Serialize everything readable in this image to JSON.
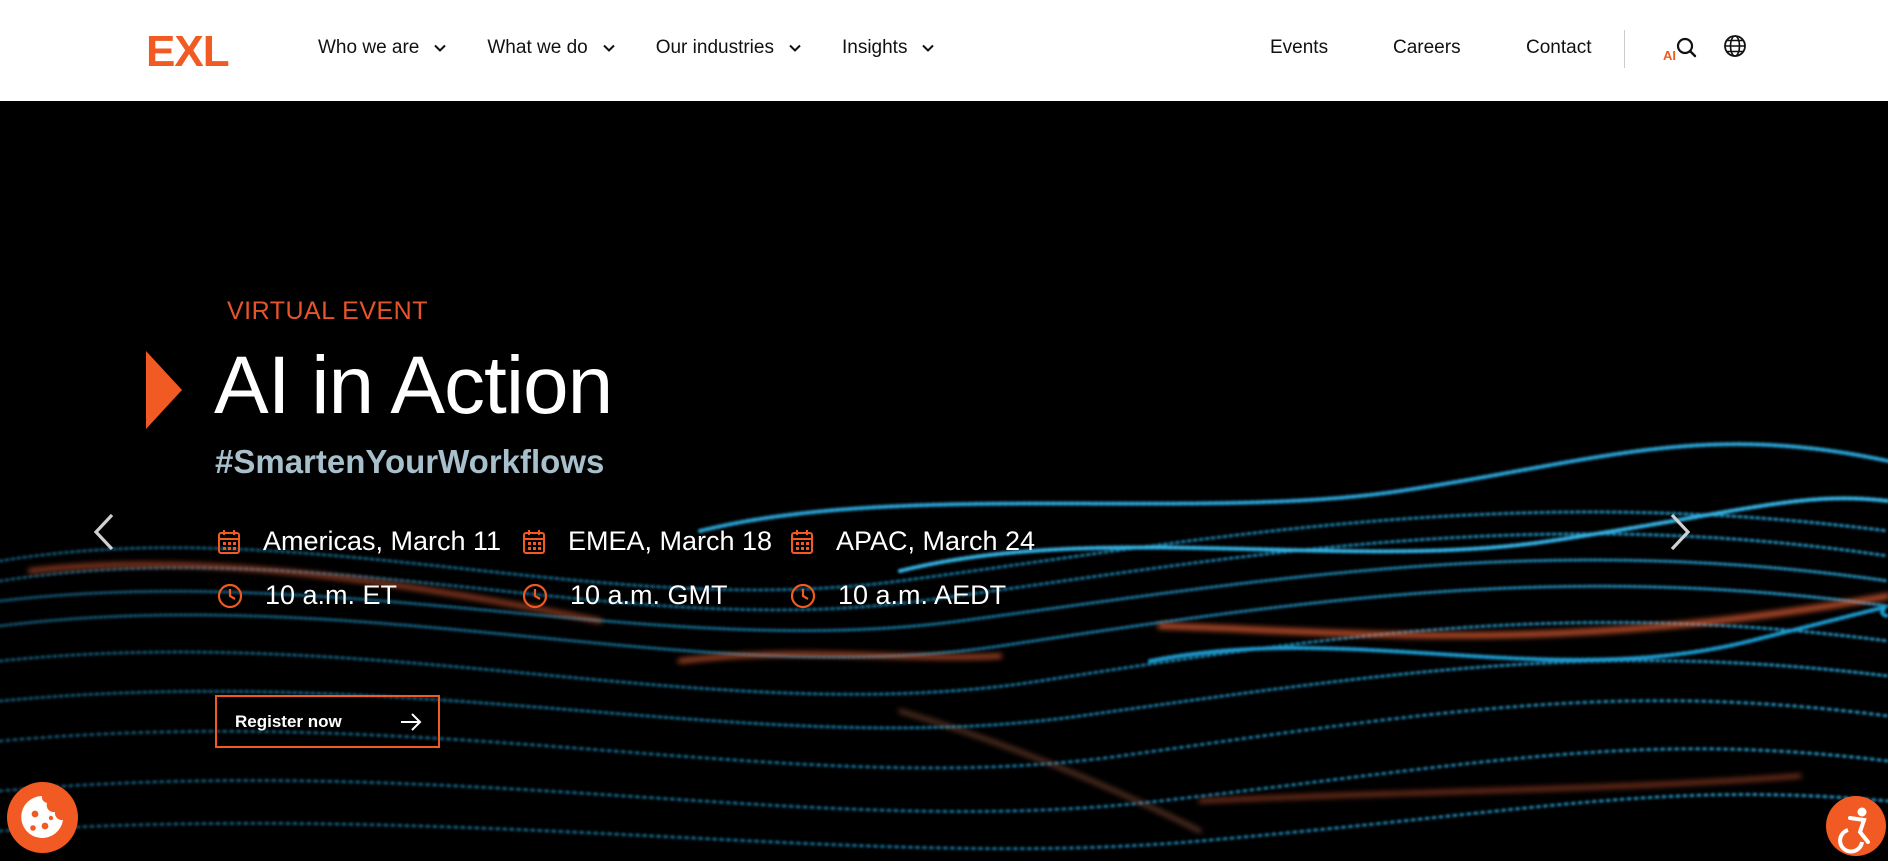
{
  "header": {
    "logo": "EXL",
    "nav": [
      {
        "label": "Who we are"
      },
      {
        "label": "What we do"
      },
      {
        "label": "Our industries"
      },
      {
        "label": "Insights"
      }
    ],
    "right_links": [
      {
        "label": "Events"
      },
      {
        "label": "Careers"
      },
      {
        "label": "Contact"
      }
    ],
    "ai_badge": "AI"
  },
  "hero": {
    "eyebrow": "VIRTUAL EVENT",
    "title": "AI in Action",
    "hashtag": "#SmartenYourWorkflows",
    "sessions": [
      {
        "date": "Americas, March 11",
        "time": "10 a.m. ET"
      },
      {
        "date": "EMEA, March 18",
        "time": "10 a.m. GMT"
      },
      {
        "date": "APAC, March 24",
        "time": "10 a.m. AEDT"
      }
    ],
    "cta": "Register now"
  },
  "colors": {
    "accent": "#f15a22",
    "hashtag": "#a8c0cc",
    "background": "#000000"
  }
}
